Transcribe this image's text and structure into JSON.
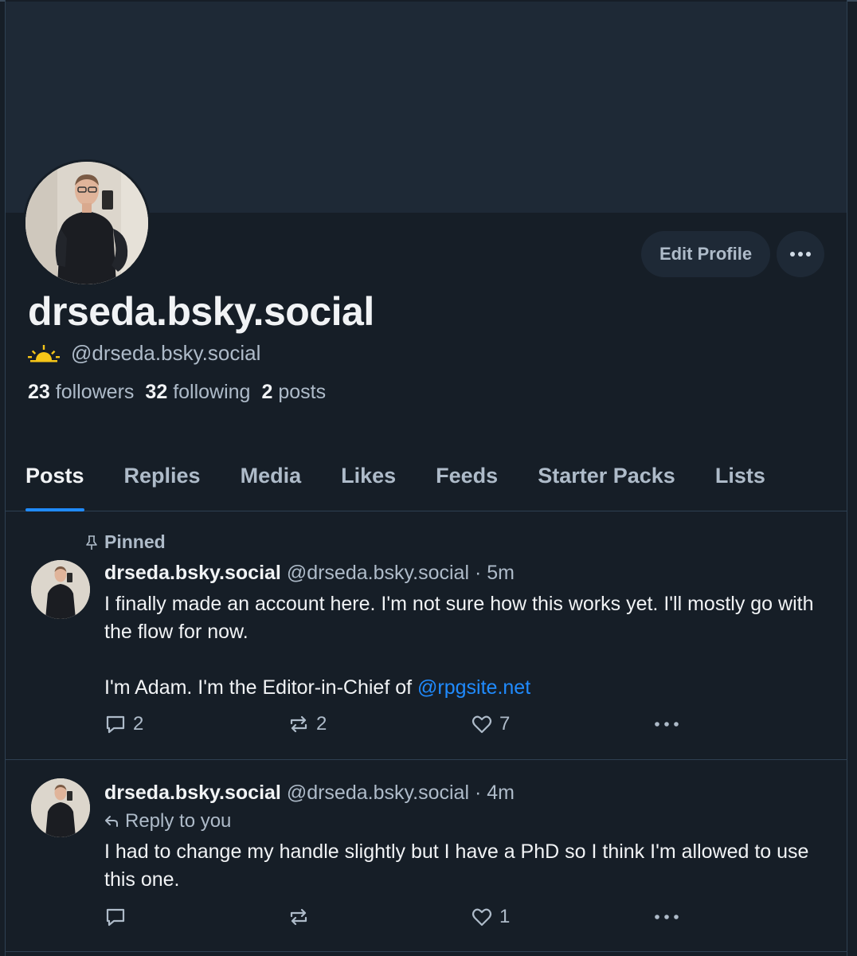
{
  "profile": {
    "display_name": "drseda.bsky.social",
    "handle": "@drseda.bsky.social",
    "handle_icon": "sunrise-icon",
    "followers_count": "23",
    "followers_label": "followers",
    "following_count": "32",
    "following_label": "following",
    "posts_count": "2",
    "posts_label": "posts",
    "edit_button": "Edit Profile"
  },
  "tabs": [
    {
      "label": "Posts",
      "active": true
    },
    {
      "label": "Replies"
    },
    {
      "label": "Media"
    },
    {
      "label": "Likes"
    },
    {
      "label": "Feeds"
    },
    {
      "label": "Starter Packs"
    },
    {
      "label": "Lists"
    }
  ],
  "posts": [
    {
      "pinned_label": "Pinned",
      "author": "drseda.bsky.social",
      "handle": "@drseda.bsky.social",
      "time": "· 5m",
      "text_line1": "I finally made an account here. I'm not sure how this works yet. I'll mostly go with the flow for now.",
      "text_line2_prefix": "I'm Adam. I'm the Editor-in-Chief of ",
      "mention": "@rpgsite.net",
      "replies": "2",
      "reposts": "2",
      "likes": "7"
    },
    {
      "author": "drseda.bsky.social",
      "handle": "@drseda.bsky.social",
      "time": "· 4m",
      "reply_to": "Reply to you",
      "text": "I had to change my handle slightly but I have a PhD so I think I'm allowed to use this one.",
      "replies": "",
      "reposts": "",
      "likes": "1"
    }
  ],
  "colors": {
    "background": "#161e27",
    "banner": "#1e2936",
    "accent": "#208bfe",
    "text_primary": "#f1f3f5",
    "text_secondary": "#aebbc9",
    "border": "#2e4052",
    "sun": "#f5c518"
  }
}
